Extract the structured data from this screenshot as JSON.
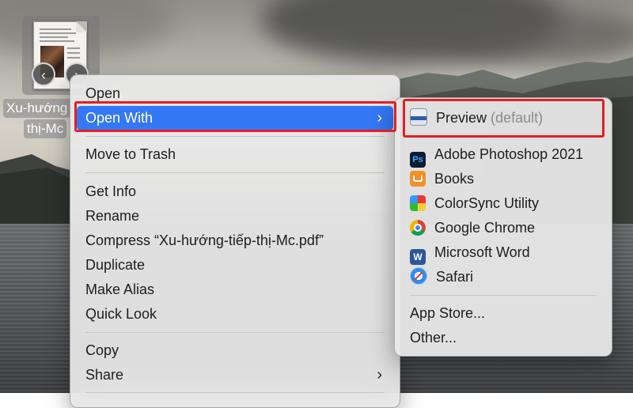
{
  "desktop": {
    "file": {
      "label_line1": "Xu-hướng",
      "label_line2": "thị-Mc",
      "prev_glyph": "‹",
      "next_glyph": "›"
    }
  },
  "context_menu": {
    "items": {
      "open": "Open",
      "open_with": "Open With",
      "move_to_trash": "Move to Trash",
      "get_info": "Get Info",
      "rename": "Rename",
      "compress": "Compress “Xu-hướng-tiếp-thị-Mc.pdf”",
      "duplicate": "Duplicate",
      "make_alias": "Make Alias",
      "quick_look": "Quick Look",
      "copy": "Copy",
      "share": "Share"
    },
    "submenu_chevron": "›",
    "selected_color": "#3478f6"
  },
  "open_with_submenu": {
    "default_app": {
      "name": "Preview",
      "suffix": "(default)",
      "icon": "preview-icon"
    },
    "apps": [
      {
        "name": "Adobe Photoshop 2021",
        "icon": "photoshop-icon",
        "icon_text": "Ps"
      },
      {
        "name": "Books",
        "icon": "books-icon"
      },
      {
        "name": "ColorSync Utility",
        "icon": "colorsync-icon"
      },
      {
        "name": "Google Chrome",
        "icon": "chrome-icon"
      },
      {
        "name": "Microsoft Word",
        "icon": "word-icon",
        "icon_text": "W"
      },
      {
        "name": "Safari",
        "icon": "safari-icon"
      }
    ],
    "app_store": "App Store...",
    "other": "Other..."
  },
  "annotations": {
    "highlight_color": "#e41e26"
  }
}
